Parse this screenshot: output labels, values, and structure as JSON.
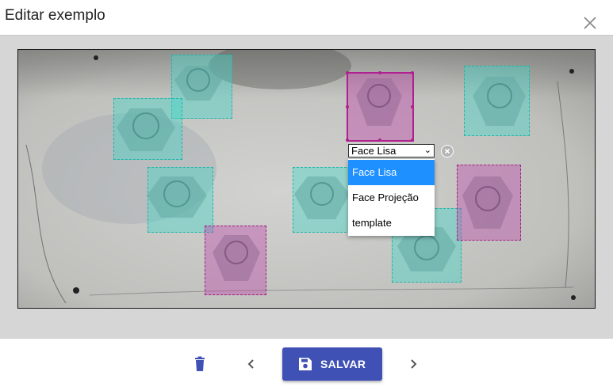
{
  "dialog": {
    "title": "Editar exemplo",
    "close_icon": "close-icon"
  },
  "annotation": {
    "selected_label": "Face Lisa",
    "options": [
      "Face Lisa",
      "Face Projeção",
      "template"
    ],
    "active_option": "Face Lisa",
    "remove_icon": "remove-circle-icon"
  },
  "labels_legend": {
    "Face Lisa": "#40d6c8",
    "Face Projeção": "#be3caa"
  },
  "boxes": [
    {
      "label": "Face Lisa"
    },
    {
      "label": "Face Lisa"
    },
    {
      "label": "Face Lisa"
    },
    {
      "label": "Face Lisa"
    },
    {
      "label": "Face Lisa"
    },
    {
      "label": "Face Lisa"
    },
    {
      "label": "Face Projeção"
    },
    {
      "label": "Face Projeção"
    },
    {
      "label": "Face Projeção"
    }
  ],
  "footer": {
    "delete_icon": "trash-icon",
    "prev_icon": "chevron-left-icon",
    "save_label": "SALVAR",
    "save_icon": "floppy-disk-icon",
    "next_icon": "chevron-right-icon"
  },
  "colors": {
    "primary": "#3f51b5",
    "option_highlight": "#1e90ff",
    "overlay": "#d6d6d6"
  }
}
